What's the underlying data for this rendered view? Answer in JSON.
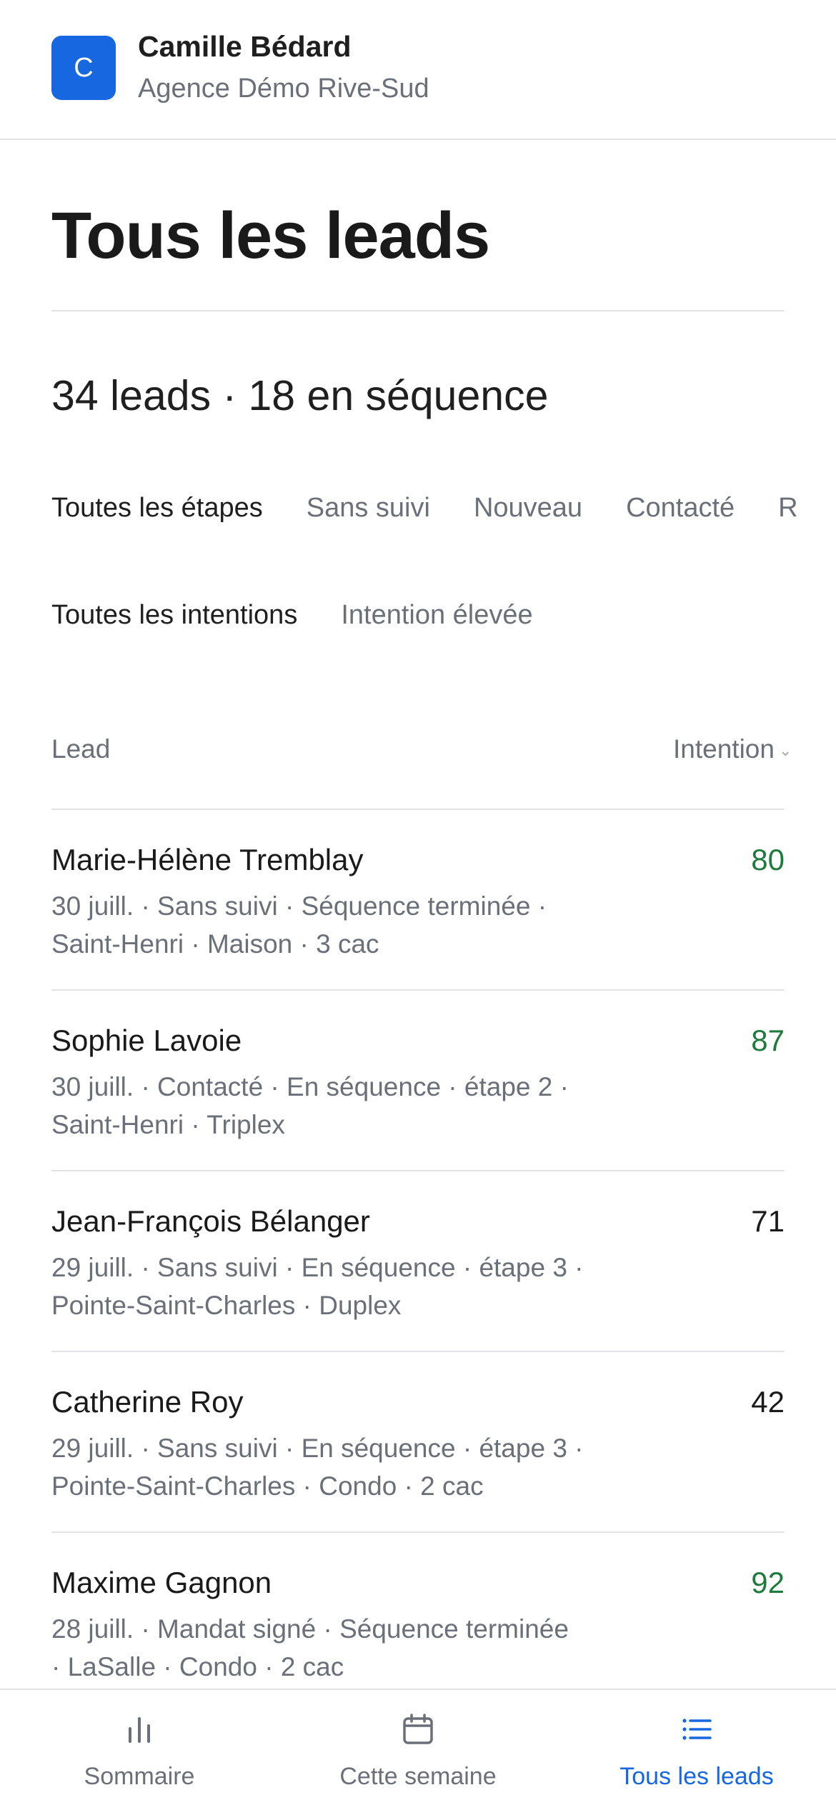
{
  "header": {
    "avatar_initial": "C",
    "user_name": "Camille Bédard",
    "agency": "Agence Démo Rive-Sud"
  },
  "page": {
    "title": "Tous les leads",
    "summary": "34 leads · 18 en séquence"
  },
  "filters": {
    "stages": [
      "Toutes les étapes",
      "Sans suivi",
      "Nouveau",
      "Contacté",
      "R"
    ],
    "stages_selected": "Toutes les étapes",
    "intents": [
      "Toutes les intentions",
      "Intention élevée"
    ],
    "intents_selected": "Toutes les intentions"
  },
  "table": {
    "col_lead": "Lead",
    "col_intent": "Intention",
    "rows": [
      {
        "name": "Marie-Hélène Tremblay",
        "meta_line1": "30 juill. · Sans suivi · Séquence terminée ·",
        "meta_line2": "Saint-Henri · Maison · 3 cac",
        "score": "80",
        "high": true
      },
      {
        "name": "Sophie Lavoie",
        "meta_line1": "30 juill. · Contacté · En séquence · étape 2 ·",
        "meta_line2": "Saint-Henri · Triplex",
        "score": "87",
        "high": true
      },
      {
        "name": "Jean-François Bélanger",
        "meta_line1": "29 juill. · Sans suivi · En séquence · étape 3 ·",
        "meta_line2": "Pointe-Saint-Charles · Duplex",
        "score": "71",
        "high": false
      },
      {
        "name": "Catherine Roy",
        "meta_line1": "29 juill. · Sans suivi · En séquence · étape 3 ·",
        "meta_line2": "Pointe-Saint-Charles · Condo · 2 cac",
        "score": "42",
        "high": false
      },
      {
        "name": "Maxime Gagnon",
        "meta_line1": "28 juill. · Mandat signé · Séquence terminée",
        "meta_line2": "· LaSalle · Condo · 2 cac",
        "score": "92",
        "high": true
      }
    ]
  },
  "tabbar": {
    "items": [
      {
        "label": "Sommaire",
        "icon": "bar-chart-icon"
      },
      {
        "label": "Cette semaine",
        "icon": "calendar-icon"
      },
      {
        "label": "Tous les leads",
        "icon": "list-icon"
      }
    ],
    "active": "Tous les leads"
  },
  "colors": {
    "accent": "#1667e0",
    "high_score": "#1f7a3e",
    "muted_text": "#6b7078",
    "divider": "#e2e3e6"
  }
}
